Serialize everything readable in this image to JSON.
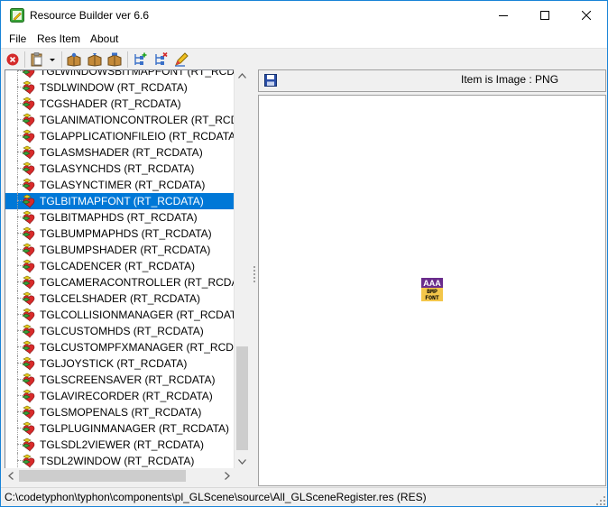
{
  "window": {
    "title": "Resource Builder ver 6.6"
  },
  "menu": [
    {
      "label": "File"
    },
    {
      "label": "Res Item"
    },
    {
      "label": "About"
    }
  ],
  "toolbar": {
    "icons": [
      "close-icon",
      "new-dropdown-icon",
      "open-icon",
      "paste-icon",
      "replace-icon",
      "add-item-icon",
      "delete-item-icon",
      "edit-icon"
    ]
  },
  "tree": {
    "items": [
      {
        "label": "TGLWINDOWSBITMAPFONT (RT_RCDATA)"
      },
      {
        "label": "TSDLWINDOW (RT_RCDATA)"
      },
      {
        "label": "TCGSHADER (RT_RCDATA)"
      },
      {
        "label": "TGLANIMATIONCONTROLER (RT_RCDATA)"
      },
      {
        "label": "TGLAPPLICATIONFILEIO (RT_RCDATA)"
      },
      {
        "label": "TGLASMSHADER (RT_RCDATA)"
      },
      {
        "label": "TGLASYNCHDS (RT_RCDATA)"
      },
      {
        "label": "TGLASYNCTIMER (RT_RCDATA)"
      },
      {
        "label": "TGLBITMAPFONT (RT_RCDATA)",
        "selected": true
      },
      {
        "label": "TGLBITMAPHDS (RT_RCDATA)"
      },
      {
        "label": "TGLBUMPMAPHDS (RT_RCDATA)"
      },
      {
        "label": "TGLBUMPSHADER (RT_RCDATA)"
      },
      {
        "label": "TGLCADENCER (RT_RCDATA)"
      },
      {
        "label": "TGLCAMERACONTROLLER (RT_RCDATA)"
      },
      {
        "label": "TGLCELSHADER (RT_RCDATA)"
      },
      {
        "label": "TGLCOLLISIONMANAGER (RT_RCDATA)"
      },
      {
        "label": "TGLCUSTOMHDS (RT_RCDATA)"
      },
      {
        "label": "TGLCUSTOMPFXMANAGER (RT_RCDATA)"
      },
      {
        "label": "TGLJOYSTICK (RT_RCDATA)"
      },
      {
        "label": "TGLSCREENSAVER (RT_RCDATA)"
      },
      {
        "label": "TGLAVIRECORDER (RT_RCDATA)"
      },
      {
        "label": "TGLSMOPENALS (RT_RCDATA)"
      },
      {
        "label": "TGLPLUGINMANAGER (RT_RCDATA)"
      },
      {
        "label": "TGLSDL2VIEWER (RT_RCDATA)"
      },
      {
        "label": "TSDL2WINDOW (RT_RCDATA)"
      }
    ]
  },
  "preview": {
    "info": "Item is Image : PNG",
    "image_text_top": "AAA",
    "image_text_mid": "BMP",
    "image_text_bot": "FONT"
  },
  "status": {
    "path": "C:\\codetyphon\\typhon\\components\\pl_GLScene\\source\\All_GLSceneRegister.res (RES)"
  },
  "colors": {
    "selection": "#0078d7",
    "window_border": "#1883d7",
    "chrome": "#f0f0f0"
  }
}
